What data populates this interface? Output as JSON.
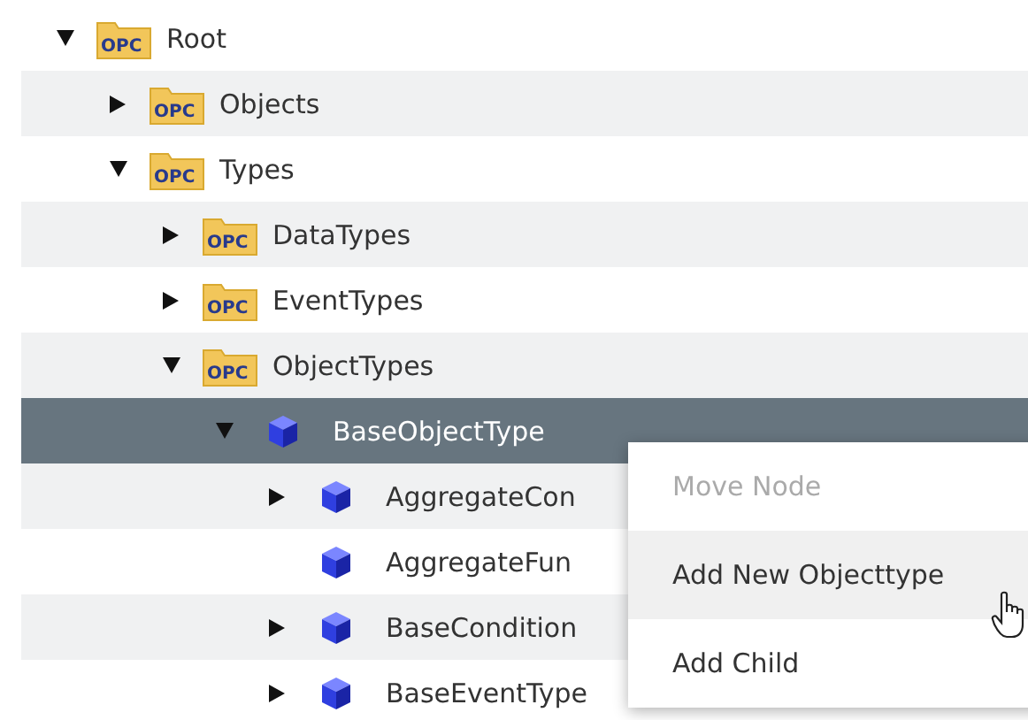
{
  "tree": [
    {
      "label": "Root",
      "kind": "folder",
      "badge": "OPC",
      "expanded": true,
      "selected": false,
      "children": [
        {
          "label": "Objects",
          "kind": "folder",
          "badge": "OPC",
          "expanded": false,
          "selected": false
        },
        {
          "label": "Types",
          "kind": "folder",
          "badge": "OPC",
          "expanded": true,
          "selected": false,
          "children": [
            {
              "label": "DataTypes",
              "kind": "folder",
              "badge": "OPC",
              "expanded": false,
              "selected": false
            },
            {
              "label": "EventTypes",
              "kind": "folder",
              "badge": "OPC",
              "expanded": false,
              "selected": false
            },
            {
              "label": "ObjectTypes",
              "kind": "folder",
              "badge": "OPC",
              "expanded": true,
              "selected": false,
              "children": [
                {
                  "label": "BaseObjectType",
                  "kind": "object",
                  "expanded": true,
                  "selected": true,
                  "children": [
                    {
                      "label": "AggregateCon",
                      "kind": "object",
                      "expanded": false,
                      "selected": false
                    },
                    {
                      "label": "AggregateFun",
                      "kind": "object",
                      "selected": false
                    },
                    {
                      "label": "BaseCondition",
                      "kind": "object",
                      "expanded": false,
                      "selected": false
                    },
                    {
                      "label": "BaseEventType",
                      "kind": "object",
                      "expanded": false,
                      "selected": false
                    }
                  ]
                }
              ]
            }
          ]
        }
      ]
    }
  ],
  "context_menu": {
    "items": [
      {
        "label": "Move Node",
        "disabled": true,
        "selected": false
      },
      {
        "label": "Add New Objecttype",
        "disabled": false,
        "selected": true
      },
      {
        "label": "Add Child",
        "disabled": false,
        "selected": false
      }
    ]
  }
}
